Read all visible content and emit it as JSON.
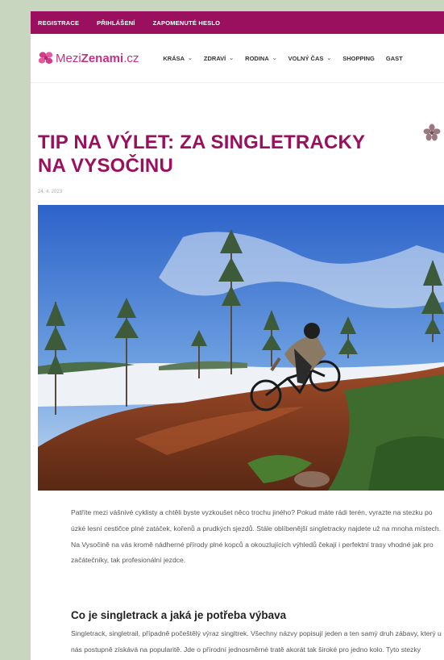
{
  "topbar": {
    "links": [
      "REGISTRACE",
      "PŘIHLÁŠENÍ",
      "ZAPOMENUTÉ HESLO"
    ]
  },
  "logo": {
    "part1": "Mezi",
    "part2": "Zenami",
    "part3": ".cz"
  },
  "menu": [
    {
      "label": "KRÁSA",
      "dropdown": true
    },
    {
      "label": "ZDRAVÍ",
      "dropdown": true
    },
    {
      "label": "RODINA",
      "dropdown": true
    },
    {
      "label": "VOLNÝ ČAS",
      "dropdown": true
    },
    {
      "label": "SHOPPING",
      "dropdown": false
    },
    {
      "label": "GAST",
      "dropdown": false
    }
  ],
  "article": {
    "title": "TIP NA VÝLET: ZA SINGLETRACKY NA VYSOČINU",
    "date": "24. 4. 2023",
    "intro": "Patříte mezi vášnivé cyklisty a chtěli byste vyzkoušet něco trochu jiného? Pokud máte rádi terén, vyrazte na stezku po úzké lesní cestičce plné zatáček, kořenů a prudkých sjezdů. Stále oblíbenější singletracky najdete už na mnoha místech.  Na Vysočině na vás kromě nádherné přírody plné kopců a okouzlujících výhledů čekají i perfektní trasy vhodné jak pro začátečníky, tak profesionální jezdce.",
    "section_heading": "Co je singletrack a jaká je potřeba výbava",
    "section_text": "Singletrack, singletrail, případně počeštělý výraz singltrek. Všechny názvy popisují jeden a ten samý druh zábavy, který u nás postupně získává na popularitě. Jde o přírodní jednosměrné tratě akorát tak široké pro jedno kolo. Tyto stezky maximálně využívají terén,"
  },
  "colors": {
    "brand": "#9b0f5f",
    "logo": "#c23184"
  }
}
